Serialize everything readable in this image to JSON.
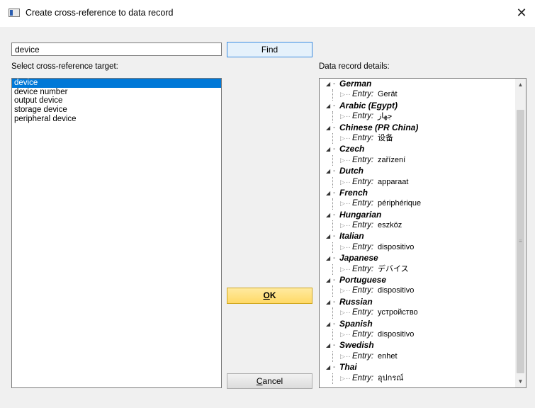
{
  "window": {
    "title": "Create cross-reference to data record",
    "close_glyph": "✕"
  },
  "search": {
    "value": "device",
    "find_label": "Find"
  },
  "targets": {
    "label": "Select cross-reference target:",
    "items": [
      "device",
      "device number",
      "output device",
      "storage device",
      "peripheral device"
    ],
    "selected_index": 0
  },
  "details": {
    "label": "Data record details:",
    "entry_label": "Entry:",
    "languages": [
      {
        "name": "German",
        "entry": "Gerät"
      },
      {
        "name": "Arabic (Egypt)",
        "entry": "جهاز"
      },
      {
        "name": "Chinese (PR China)",
        "entry": "设备"
      },
      {
        "name": "Czech",
        "entry": "zařízení"
      },
      {
        "name": "Dutch",
        "entry": "apparaat"
      },
      {
        "name": "French",
        "entry": "périphérique"
      },
      {
        "name": "Hungarian",
        "entry": "eszköz"
      },
      {
        "name": "Italian",
        "entry": "dispositivo"
      },
      {
        "name": "Japanese",
        "entry": "デバイス"
      },
      {
        "name": "Portuguese",
        "entry": "dispositivo"
      },
      {
        "name": "Russian",
        "entry": "устройство"
      },
      {
        "name": "Spanish",
        "entry": "dispositivo"
      },
      {
        "name": "Swedish",
        "entry": "enhet"
      },
      {
        "name": "Thai",
        "entry": "อุปกรณ์"
      }
    ]
  },
  "buttons": {
    "ok_mnemonic": "O",
    "ok_rest": "K",
    "cancel_mnemonic": "C",
    "cancel_rest": "ancel"
  },
  "colors": {
    "selection": "#0078d7",
    "ok_button": "#ffd966",
    "find_border": "#3c8ce0"
  }
}
